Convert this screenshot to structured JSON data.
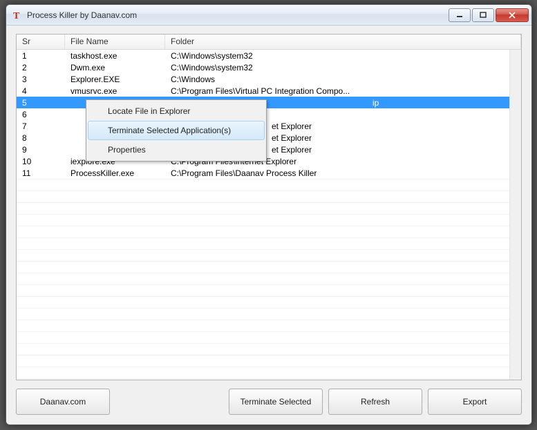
{
  "window": {
    "title": "Process Killer by Daanav.com"
  },
  "columns": {
    "sr": "Sr",
    "name": "File Name",
    "folder": "Folder"
  },
  "rows": [
    {
      "sr": "1",
      "name": "taskhost.exe",
      "folder": "C:\\Windows\\system32"
    },
    {
      "sr": "2",
      "name": "Dwm.exe",
      "folder": "C:\\Windows\\system32"
    },
    {
      "sr": "3",
      "name": "Explorer.EXE",
      "folder": "C:\\Windows"
    },
    {
      "sr": "4",
      "name": "vmusrvc.exe",
      "folder": "C:\\Program Files\\Virtual PC Integration Compo..."
    },
    {
      "sr": "5",
      "name": "",
      "folder": ""
    },
    {
      "sr": "6",
      "name": "",
      "folder": ""
    },
    {
      "sr": "7",
      "name": "",
      "folder": "et Explorer"
    },
    {
      "sr": "8",
      "name": "",
      "folder": "et Explorer"
    },
    {
      "sr": "9",
      "name": "",
      "folder": "et Explorer"
    },
    {
      "sr": "10",
      "name": "iexplore.exe",
      "folder": "C:\\Program Files\\Internet Explorer"
    },
    {
      "sr": "11",
      "name": "ProcessKiller.exe",
      "folder": "C:\\Program Files\\Daanav Process Killer"
    }
  ],
  "selected_row_folder_full": "ip",
  "context_menu": {
    "items": [
      "Locate File in Explorer",
      "Terminate Selected Application(s)",
      "Properties"
    ],
    "hover_index": 1
  },
  "buttons": {
    "daanav": "Daanav.com",
    "terminate": "Terminate Selected",
    "refresh": "Refresh",
    "export": "Export"
  }
}
